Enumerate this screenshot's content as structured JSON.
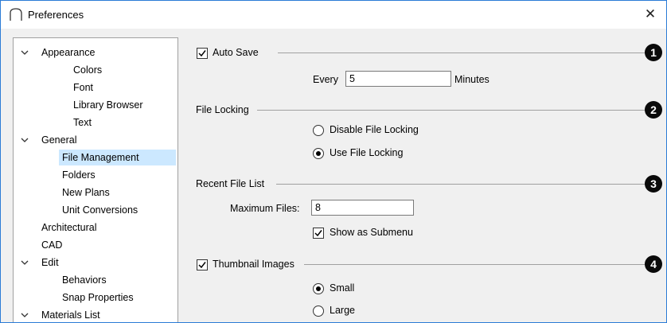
{
  "window": {
    "title": "Preferences",
    "close_glyph": "✕",
    "icon": "arch-icon"
  },
  "tree": {
    "items": [
      {
        "label": "Appearance",
        "level": 0,
        "expanded": true
      },
      {
        "label": "Colors",
        "level": 1
      },
      {
        "label": "Font",
        "level": 1
      },
      {
        "label": "Library Browser",
        "level": 1
      },
      {
        "label": "Text",
        "level": 1
      },
      {
        "label": "General",
        "level": 0,
        "expanded": true
      },
      {
        "label": "File Management",
        "level": 1,
        "selected": true
      },
      {
        "label": "Folders",
        "level": 1
      },
      {
        "label": "New Plans",
        "level": 1
      },
      {
        "label": "Unit Conversions",
        "level": 1
      },
      {
        "label": "Architectural",
        "level": 0
      },
      {
        "label": "CAD",
        "level": 0
      },
      {
        "label": "Edit",
        "level": 0,
        "expanded": true
      },
      {
        "label": "Behaviors",
        "level": 1
      },
      {
        "label": "Snap Properties",
        "level": 1
      },
      {
        "label": "Materials List",
        "level": 0,
        "expanded": true
      }
    ]
  },
  "auto_save": {
    "label": "Auto Save",
    "checked": true,
    "every_label": "Every",
    "every_value": "5",
    "minutes_label": "Minutes",
    "badge": "1"
  },
  "file_locking": {
    "label": "File Locking",
    "disable_label": "Disable File Locking",
    "use_label": "Use File Locking",
    "selected": "use",
    "badge": "2"
  },
  "recent_files": {
    "label": "Recent File List",
    "max_label": "Maximum Files:",
    "max_value": "8",
    "submenu_label": "Show as Submenu",
    "submenu_checked": true,
    "badge": "3"
  },
  "thumbnails": {
    "label": "Thumbnail Images",
    "checked": true,
    "small_label": "Small",
    "large_label": "Large",
    "selected": "small",
    "badge": "4"
  }
}
